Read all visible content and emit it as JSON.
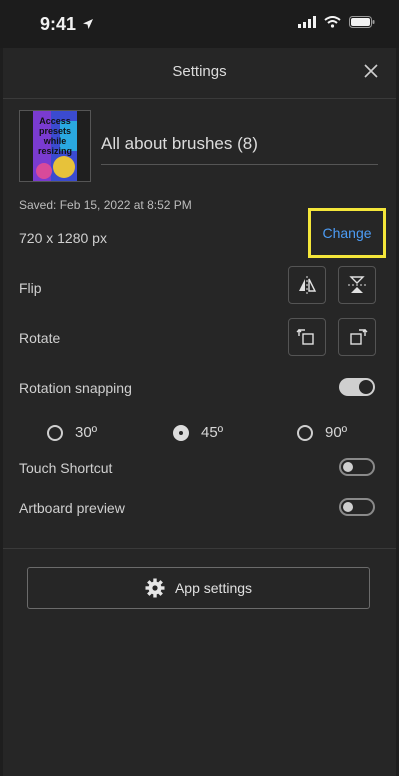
{
  "status_bar": {
    "time": "9:41"
  },
  "header": {
    "title": "Settings"
  },
  "document": {
    "thumbnail_text": "Access presets while resizing",
    "title": "All about brushes (8)",
    "saved": "Saved: Feb 15, 2022 at 8:52 PM",
    "dimensions": "720 x 1280 px",
    "change_label": "Change"
  },
  "rows": {
    "flip": "Flip",
    "rotate": "Rotate",
    "rotation_snapping": "Rotation snapping",
    "touch_shortcut": "Touch Shortcut",
    "artboard_preview": "Artboard preview"
  },
  "toggles": {
    "rotation_snapping": true,
    "touch_shortcut": false,
    "artboard_preview": false
  },
  "snap_angles": [
    {
      "label": "30º",
      "checked": false
    },
    {
      "label": "45º",
      "checked": true
    },
    {
      "label": "90º",
      "checked": false
    }
  ],
  "app_settings_label": "App settings",
  "colors": {
    "accent": "#4c9cf5",
    "highlight": "#f4e63a",
    "background": "#262626"
  }
}
